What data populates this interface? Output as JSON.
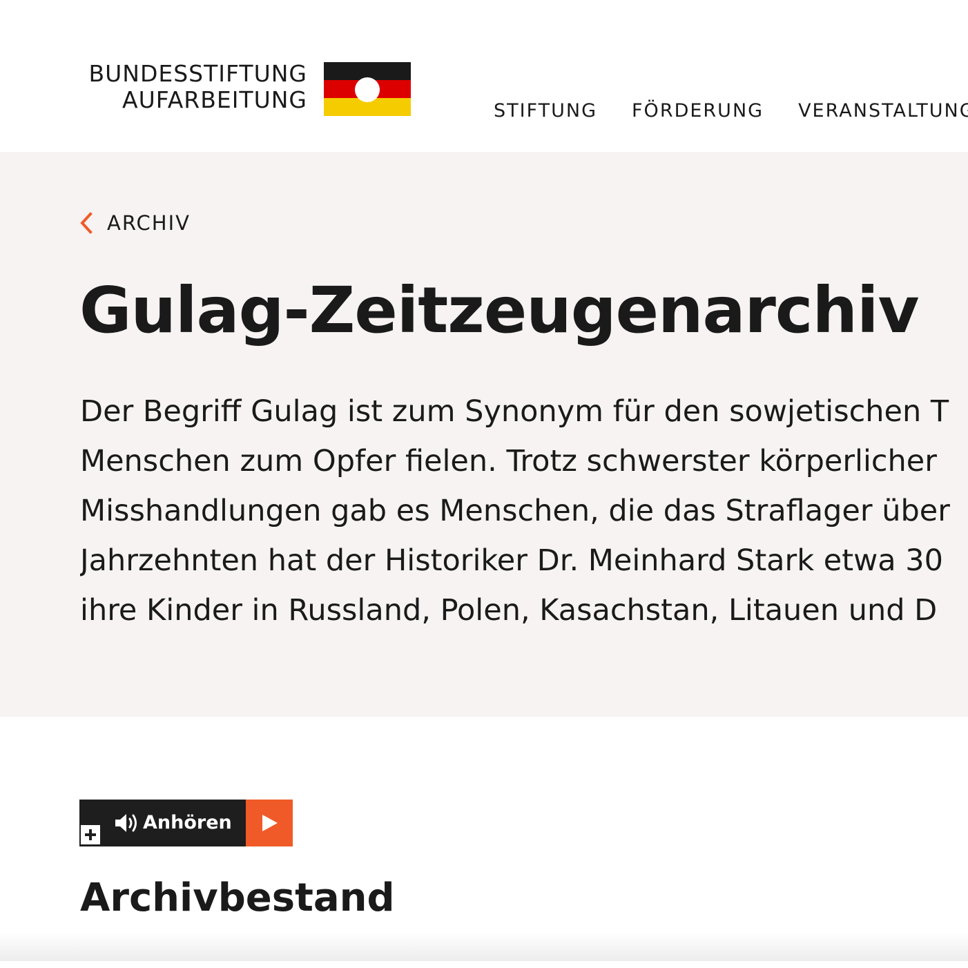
{
  "header": {
    "logo": {
      "line1": "BUNDESSTIFTUNG",
      "line2": "AUFARBEITUNG",
      "flag_colors": [
        "#1a1a1a",
        "#dd0000",
        "#f5cc00"
      ]
    },
    "nav": {
      "items": [
        {
          "label": "STIFTUNG"
        },
        {
          "label": "FÖRDERUNG"
        },
        {
          "label": "VERANSTALTUNGEN"
        }
      ]
    }
  },
  "hero": {
    "back_link": {
      "label": "ARCHIV",
      "icon": "chevron-left-icon"
    },
    "title": "Gulag-Zeitzeugenarchiv",
    "intro_lines": [
      "Der Begriff Gulag ist zum Synonym für den sowjetischen T",
      "Menschen zum Opfer fielen. Trotz schwerster körperlicher",
      "Misshandlungen gab es Menschen, die das Straflager über",
      "Jahrzehnten hat der Historiker Dr. Meinhard Stark etwa 30",
      "ihre Kinder in Russland, Polen, Kasachstan, Litauen und D"
    ],
    "background": "#f6f3f2"
  },
  "listen_widget": {
    "label": "Anhören",
    "icons": {
      "speaker": "speaker-icon",
      "plus": "plus-icon",
      "play": "play-icon"
    },
    "accent": "#f05a28"
  },
  "main": {
    "section_heading": "Archivbestand"
  }
}
